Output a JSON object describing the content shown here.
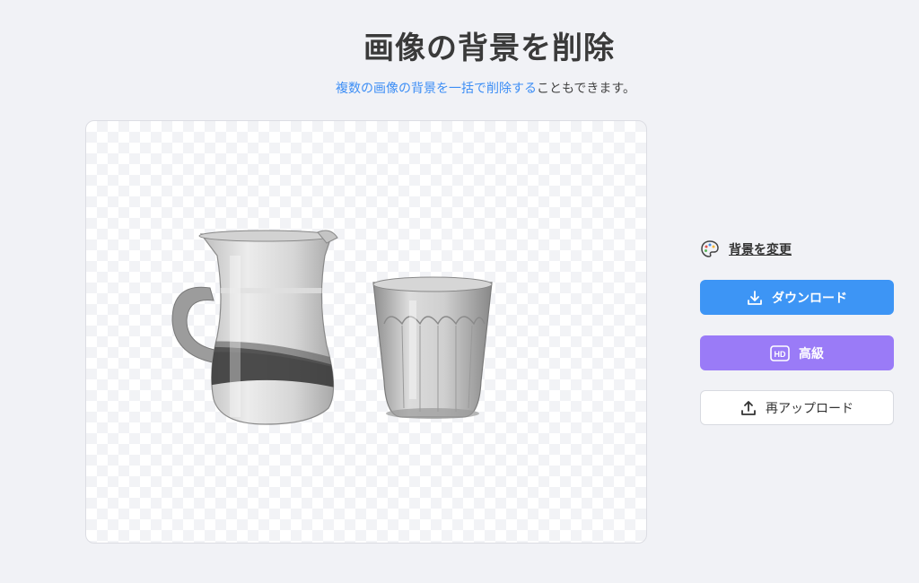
{
  "header": {
    "title": "画像の背景を削除",
    "subtitle_link": "複数の画像の背景を一括で削除する",
    "subtitle_rest": "こともできます。"
  },
  "sidebar": {
    "change_background_label": "背景を変更",
    "download_label": "ダウンロード",
    "hd_label": "高級",
    "hd_badge": "HD",
    "reupload_label": "再アップロード"
  },
  "colors": {
    "download_button": "#3d95f5",
    "hd_button": "#9a7bf7",
    "link": "#3d8ef5"
  },
  "icons": {
    "change_background": "palette-icon",
    "download": "download-icon",
    "hd": "hd-badge-icon",
    "reupload": "upload-icon"
  }
}
